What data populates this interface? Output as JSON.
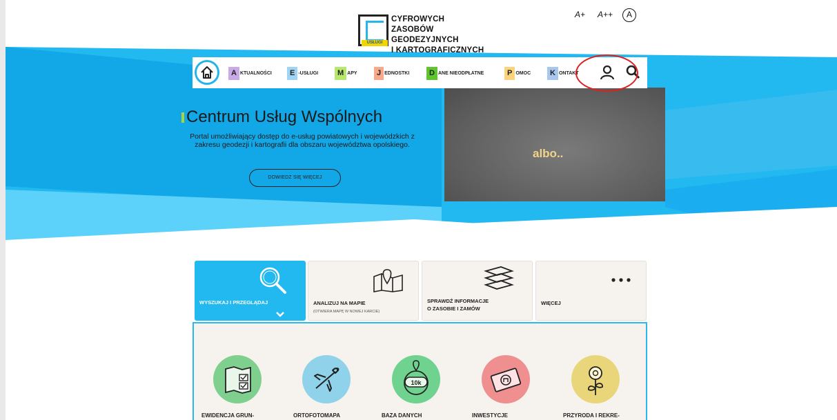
{
  "header": {
    "logo_lines": [
      "CYFROWYCH ZASOBÓW",
      "GEODEZYJNYCH",
      "I KARTOGRAFICZNYCH"
    ],
    "logo_badge": "USŁUGI",
    "font_increase": "A+",
    "font_increase_more": "A++",
    "contrast": "A"
  },
  "nav": {
    "items": [
      {
        "cap": "A",
        "rest": "KTUALNOŚCI",
        "color": "#c9a9e6"
      },
      {
        "cap": "E",
        "rest": "-USŁUGI",
        "color": "#9fd4f4"
      },
      {
        "cap": "M",
        "rest": "APY",
        "color": "#b6e86c"
      },
      {
        "cap": "J",
        "rest": "EDNOSTKI",
        "color": "#f7a98a"
      },
      {
        "cap": "D",
        "rest": "ANE NIEODPŁATNE",
        "color": "#5ec52e"
      },
      {
        "cap": "P",
        "rest": "OMOC",
        "color": "#fbd37b"
      },
      {
        "cap": "K",
        "rest": "ONTAKT",
        "color": "#a8c6ee"
      }
    ]
  },
  "hero": {
    "title": "Centrum Usług Wspólnych",
    "description": "Portal umożliwiający dostęp do e-usług powiatowych i wojewódzkich z zakresu geodezji i kartografii dla obszaru województwa opolskiego.",
    "button": "DOWIEDZ SIĘ WIĘCEJ",
    "overlay_text": "albo.."
  },
  "tiles": [
    {
      "label": "WYSZUKAJ I PRZEGLĄDAJ",
      "sub": ""
    },
    {
      "label": "ANALIZUJ NA MAPIE",
      "sub": "(OTWIERA MAPĘ W NOWEJ KARCIE)"
    },
    {
      "label": "SPRAWDŹ INFORMACJE\nO ZASOBIE I ZAMÓW",
      "sub": ""
    },
    {
      "label": "WIĘCEJ",
      "sub": ""
    }
  ],
  "services": [
    {
      "label": "EWIDENCJA GRUN-",
      "color": "#7fcf8f"
    },
    {
      "label": "ORTOFOTOMAPA",
      "color": "#8fd2ea"
    },
    {
      "label": "BAZA DANYCH",
      "color": "#6fd38f"
    },
    {
      "label": "INWESTYCJE",
      "color": "#f08f8f"
    },
    {
      "label": "PRZYRODA I REKRE-",
      "color": "#ead67a"
    }
  ],
  "colors": {
    "accent": "#25b4ea",
    "annotation": "#e02020"
  }
}
